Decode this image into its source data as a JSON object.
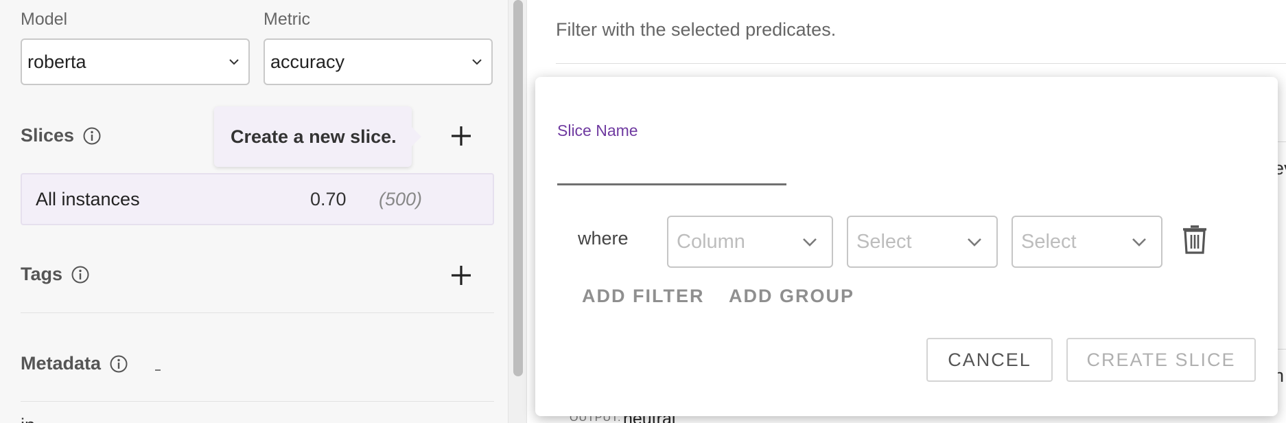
{
  "sidebar": {
    "model": {
      "label": "Model",
      "value": "roberta"
    },
    "metric": {
      "label": "Metric",
      "value": "accuracy"
    },
    "slices": {
      "title": "Slices",
      "tooltip": "Create a new slice.",
      "items": [
        {
          "name": "All instances",
          "value": "0.70",
          "count": "(500)"
        }
      ]
    },
    "tags": {
      "title": "Tags"
    },
    "metadata": {
      "title": "Metadata"
    },
    "next_section_partial": "in"
  },
  "main": {
    "filter_hint": "Filter with the selected predicates.",
    "bg_edge_texts": [
      "ev",
      "n"
    ],
    "bg_output_label": "OUTPUT:",
    "bg_output_value": "neutral"
  },
  "dialog": {
    "slice_name_label": "Slice Name",
    "slice_name_value": "",
    "where_label": "where",
    "column_placeholder": "Column",
    "operator_placeholder": "Select",
    "value_placeholder": "Select",
    "add_filter": "ADD FILTER",
    "add_group": "ADD GROUP",
    "cancel": "CANCEL",
    "create_slice": "CREATE SLICE"
  },
  "colors": {
    "accent_purple": "#6f3aa0",
    "slice_row_bg": "#f3eff8",
    "sidebar_bg": "#f7f7f7"
  },
  "icons": {
    "select_chevron": "chevron-down-icon",
    "info": "info-icon",
    "add": "plus-icon",
    "delete": "trash-icon"
  }
}
